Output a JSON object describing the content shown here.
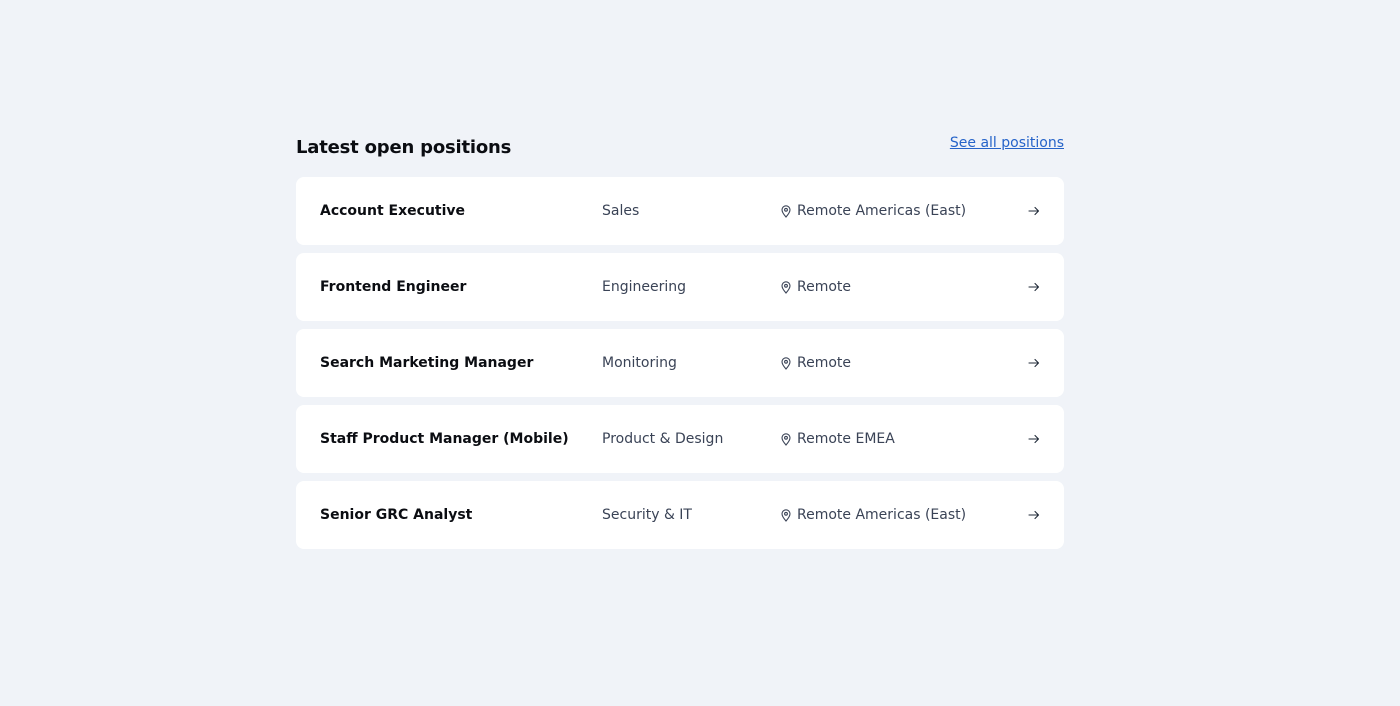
{
  "section": {
    "title": "Latest open positions",
    "see_all_label": "See all positions"
  },
  "icons": {
    "location": "map-pin-icon",
    "arrow": "arrow-right-icon"
  },
  "colors": {
    "background": "#f0f3f8",
    "card": "#ffffff",
    "link": "#2563c9",
    "secondary_text": "#3a4356"
  },
  "positions": [
    {
      "title": "Account Executive",
      "department": "Sales",
      "location": "Remote Americas (East)"
    },
    {
      "title": "Frontend Engineer",
      "department": "Engineering",
      "location": "Remote"
    },
    {
      "title": "Search Marketing Manager",
      "department": "Monitoring",
      "location": "Remote"
    },
    {
      "title": "Staff Product Manager (Mobile)",
      "department": "Product & Design",
      "location": "Remote EMEA"
    },
    {
      "title": "Senior GRC Analyst",
      "department": "Security & IT",
      "location": "Remote Americas (East)"
    }
  ]
}
